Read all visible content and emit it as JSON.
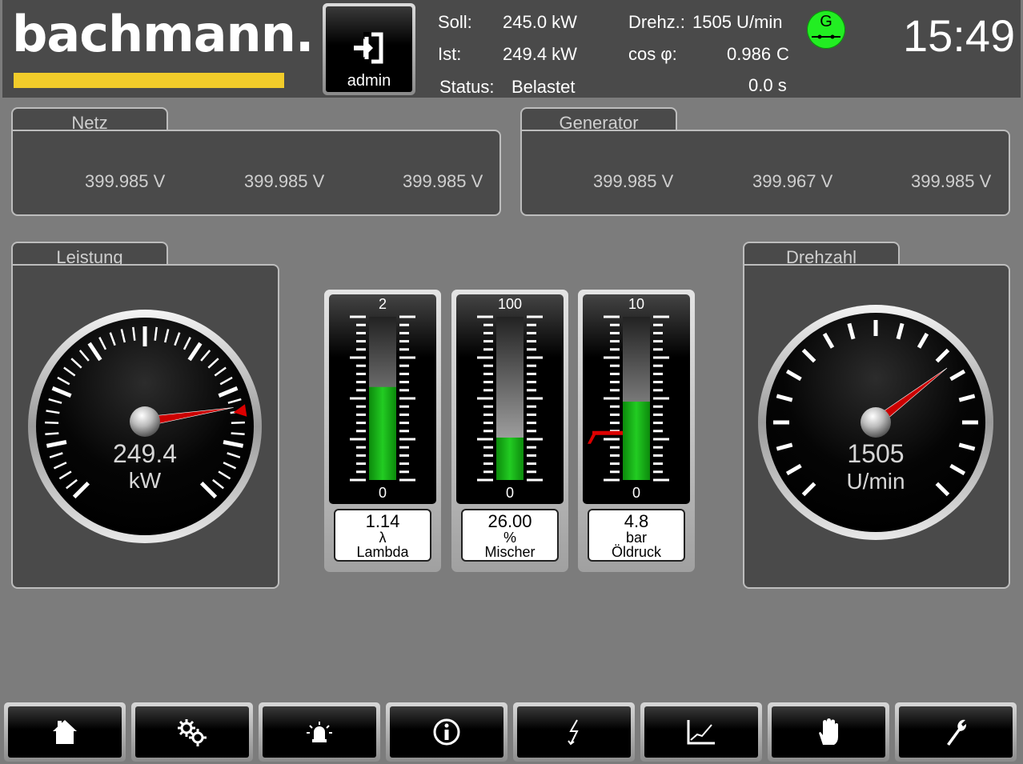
{
  "header": {
    "brand": "bachmann.",
    "user": "admin",
    "soll_label": "Soll:",
    "soll_value": "245.0 kW",
    "ist_label": "Ist:",
    "ist_value": "249.4 kW",
    "status_label": "Status:",
    "status_value": "Belastet",
    "drehz_label": "Drehz.:",
    "drehz_value": "1505 U/min",
    "cos_label": "cos φ:",
    "cos_value": "0.986",
    "cos_suffix": "C",
    "time_value": "0.0 s",
    "gen_badge": "G",
    "clock": "15:49"
  },
  "netz": {
    "title": "Netz",
    "v1": "399.985 V",
    "v2": "399.985 V",
    "v3": "399.985 V"
  },
  "generator": {
    "title": "Generator",
    "v1": "399.985 V",
    "v2": "399.967 V",
    "v3": "399.985 V"
  },
  "leistung": {
    "title": "Leistung",
    "value": "249.4",
    "unit": "kW",
    "needle_fraction": 0.8,
    "setpoint_fraction": 0.8
  },
  "drehzahl": {
    "title": "Drehzahl",
    "value": "1505",
    "unit": "U/min",
    "needle_fraction": 0.695
  },
  "bars": [
    {
      "max": "2",
      "min": "0",
      "value": "1.14",
      "unit": "λ",
      "name": "Lambda",
      "fill_fraction": 0.57,
      "setpoint_fraction": null
    },
    {
      "max": "100",
      "min": "0",
      "value": "26.00",
      "unit": "%",
      "name": "Mischer",
      "fill_fraction": 0.26,
      "setpoint_fraction": null
    },
    {
      "max": "10",
      "min": "0",
      "value": "4.8",
      "unit": "bar",
      "name": "Öldruck",
      "fill_fraction": 0.48,
      "setpoint_fraction": 0.3
    }
  ],
  "toolbar": [
    {
      "icon": "home-icon"
    },
    {
      "icon": "gears-icon"
    },
    {
      "icon": "alarm-light-icon"
    },
    {
      "icon": "info-icon"
    },
    {
      "icon": "lightning-icon"
    },
    {
      "icon": "chart-icon"
    },
    {
      "icon": "hand-icon"
    },
    {
      "icon": "wrench-icon"
    }
  ],
  "colors": {
    "accent": "#f2cc2a",
    "bar_fill": "#1fb51f",
    "needle": "#cc0000",
    "status_green": "#22ee22"
  }
}
